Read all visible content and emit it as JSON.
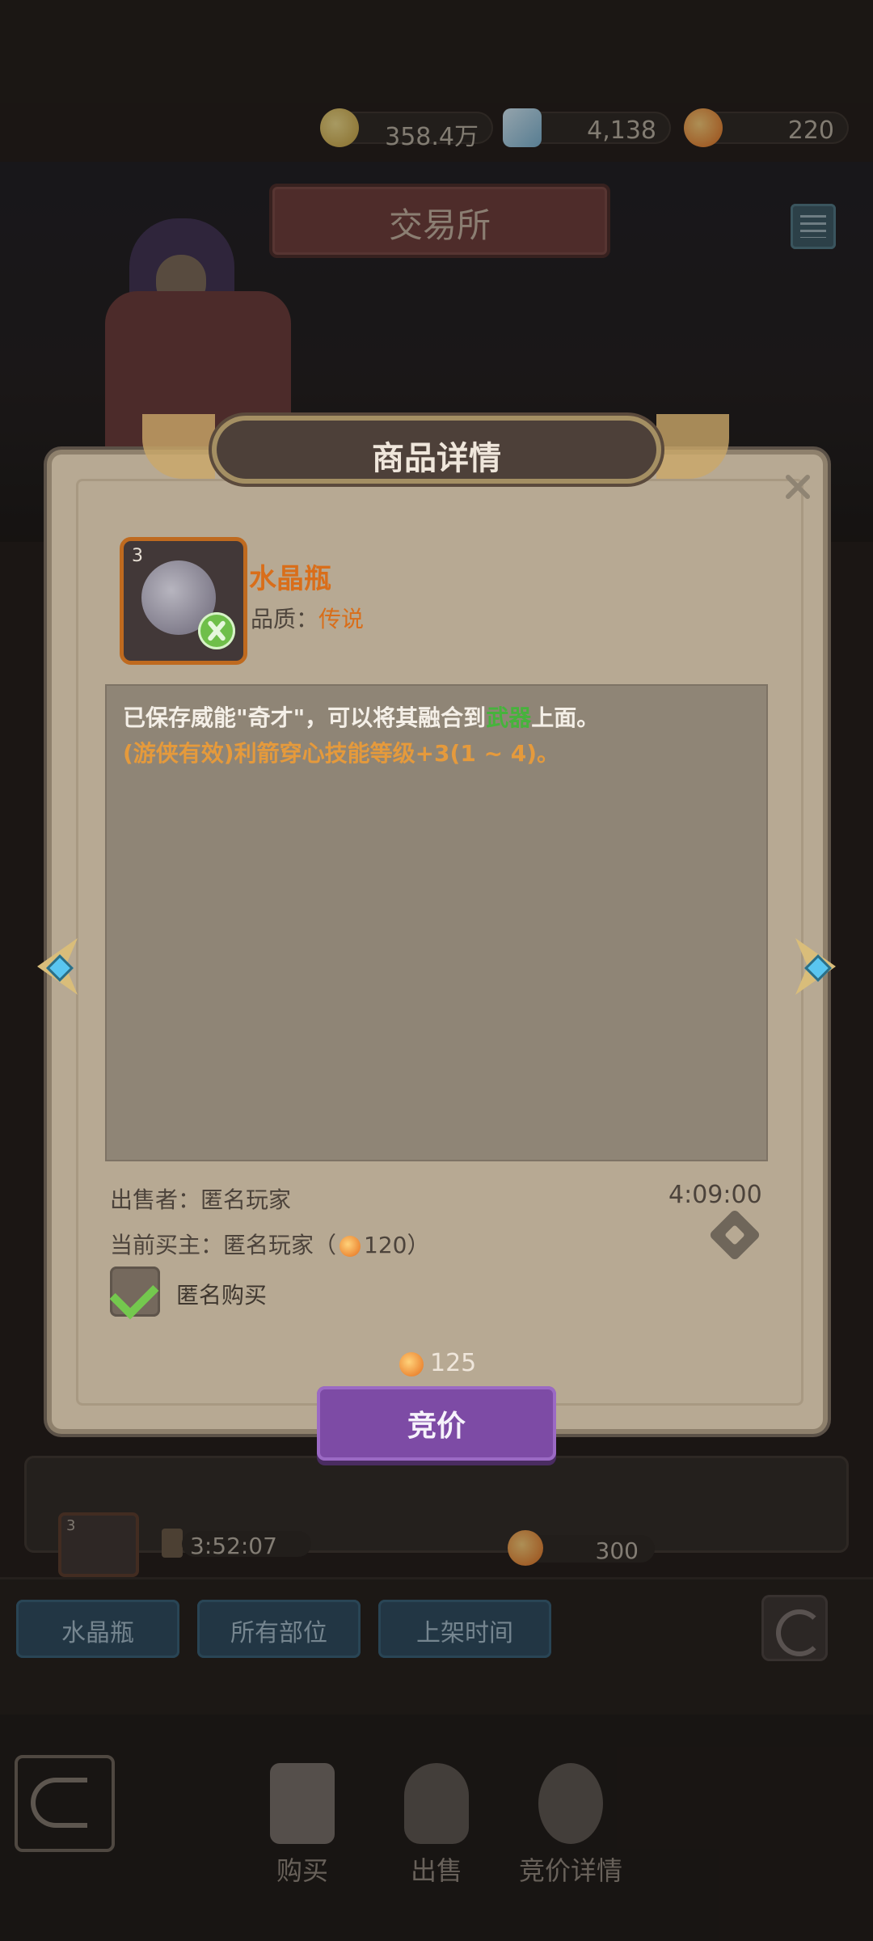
{
  "top_bar": {
    "gold": {
      "icon": "gold-coin-icon",
      "value": "358.4万"
    },
    "diamond": {
      "icon": "diamond-icon",
      "value": "4,138"
    },
    "gem": {
      "icon": "orange-gem-icon",
      "value": "220"
    }
  },
  "stage": {
    "title": "交易所",
    "menu_icon": "list-icon"
  },
  "modal": {
    "title": "商品详情",
    "close_icon": "close-icon",
    "item": {
      "count": "3",
      "name": "水晶瓶",
      "quality_label": "品质：",
      "quality_value": "传说",
      "badge_icon": "crossed-swords-icon"
    },
    "description": {
      "line1_prefix": "已保存威能\"奇才\"，可以将其融合到",
      "line1_highlight": "武器",
      "line1_suffix": "上面。",
      "line2": "(游侠有效)利箭穿心技能等级+3(1 ~ 4)。"
    },
    "seller_label": "出售者：",
    "seller_value": "匿名玩家",
    "time_left": "4:09:00",
    "buyer_label": "当前买主：",
    "buyer_value": "匿名玩家（",
    "buyer_bid": "120）",
    "hammer_icon": "auction-hammer-icon",
    "anonymous_checkbox_label": "匿名购买",
    "anonymous_checked": true,
    "next_price": "125",
    "bid_button": "竞价"
  },
  "list": {
    "row": {
      "count": "3",
      "timer": "3:52:07",
      "price": "300"
    }
  },
  "filters": {
    "item_type": "水晶瓶",
    "all_parts": "所有部位",
    "listing_time": "上架时间",
    "refresh_icon": "refresh-icon"
  },
  "bottom_nav": {
    "back_icon": "back-arrow-icon",
    "buy": "购买",
    "sell": "出售",
    "bid_details": "竞价详情"
  },
  "colors": {
    "accent_orange": "#d96e1a",
    "accent_green": "#46b33c",
    "bid_button_purple": "#7d4ba5",
    "filter_blue": "#2a4a60"
  }
}
